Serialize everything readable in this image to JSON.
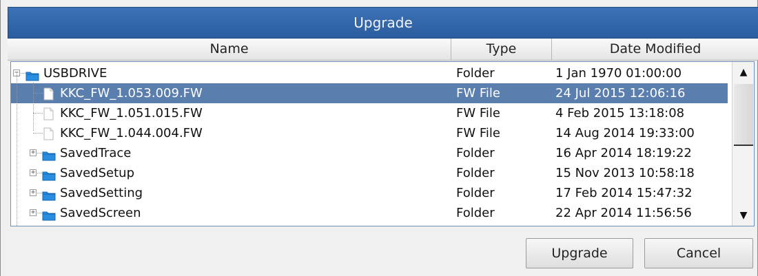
{
  "window": {
    "title": "Upgrade"
  },
  "columns": {
    "name": "Name",
    "type": "Type",
    "date": "Date Modified"
  },
  "rows": [
    {
      "name": "USBDRIVE",
      "type": "Folder",
      "date": "1 Jan 1970 01:00:00",
      "kind": "folder",
      "expander": "−",
      "selected": false
    },
    {
      "name": "KKC_FW_1.053.009.FW",
      "type": "FW File",
      "date": "24 Jul 2015 12:06:16",
      "kind": "file",
      "selected": true
    },
    {
      "name": "KKC_FW_1.051.015.FW",
      "type": "FW File",
      "date": "4 Feb 2015 13:18:08",
      "kind": "file",
      "selected": false
    },
    {
      "name": "KKC_FW_1.044.004.FW",
      "type": "FW File",
      "date": "14 Aug 2014 19:33:00",
      "kind": "file",
      "selected": false
    },
    {
      "name": "SavedTrace",
      "type": "Folder",
      "date": "16 Apr 2014 18:19:22",
      "kind": "folder",
      "expander": "+",
      "selected": false
    },
    {
      "name": "SavedSetup",
      "type": "Folder",
      "date": "15 Nov 2013 10:58:18",
      "kind": "folder",
      "expander": "+",
      "selected": false
    },
    {
      "name": "SavedSetting",
      "type": "Folder",
      "date": "17 Feb 2014 15:47:32",
      "kind": "folder",
      "expander": "+",
      "selected": false
    },
    {
      "name": "SavedScreen",
      "type": "Folder",
      "date": "22 Apr 2014 11:56:56",
      "kind": "folder",
      "expander": "+",
      "selected": false
    }
  ],
  "scrollbar": {
    "up_glyph": "▲",
    "down_glyph": "▼"
  },
  "buttons": {
    "upgrade": "Upgrade",
    "cancel": "Cancel"
  },
  "colors": {
    "titlebar": "#2f64a8",
    "selection": "#5a7eae",
    "folder": "#2a8ee0"
  }
}
